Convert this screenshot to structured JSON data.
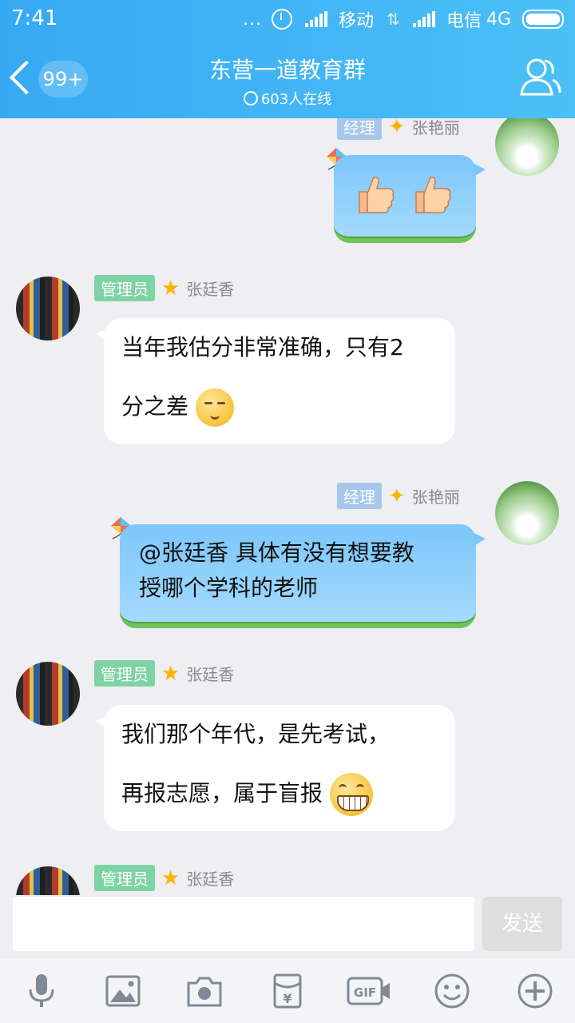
{
  "status_bar": {
    "time": "7:41",
    "dots": "...",
    "carrier1": "移动",
    "carrier2": "电信",
    "network": "4G"
  },
  "header": {
    "unread": "99+",
    "title": "东营一道教育群",
    "online": "603人在线"
  },
  "messages": [
    {
      "side": "right",
      "badge": "经理",
      "sender": "张艳丽",
      "content": "thumbs-up-emoji thumbs-up-emoji"
    },
    {
      "side": "left",
      "badge": "管理员",
      "sender": "张廷香",
      "line1": "当年我估分非常准确，只有2",
      "line2": "分之差"
    },
    {
      "side": "right",
      "badge": "经理",
      "sender": "张艳丽",
      "line1": "@张廷香 具体有没有想要教",
      "line2": "授哪个学科的老师"
    },
    {
      "side": "left",
      "badge": "管理员",
      "sender": "张廷香",
      "line1": "我们那个年代，是先考试，",
      "line2": "再报志愿，属于盲报"
    },
    {
      "side": "left",
      "badge": "管理员",
      "sender": "张廷香"
    }
  ],
  "composer": {
    "input_value": "",
    "send_label": "发送"
  },
  "toolbar_icons": [
    "microphone-icon",
    "image-icon",
    "camera-icon",
    "red-packet-icon",
    "gif-icon",
    "emoji-icon",
    "plus-icon"
  ],
  "colors": {
    "header_bg": "#37a9f4",
    "badge_manager": "#a6c6ec",
    "badge_admin": "#7ed3a5",
    "bubble_blue": "#7cc6fb",
    "bubble_grass": "#6dc45a"
  }
}
